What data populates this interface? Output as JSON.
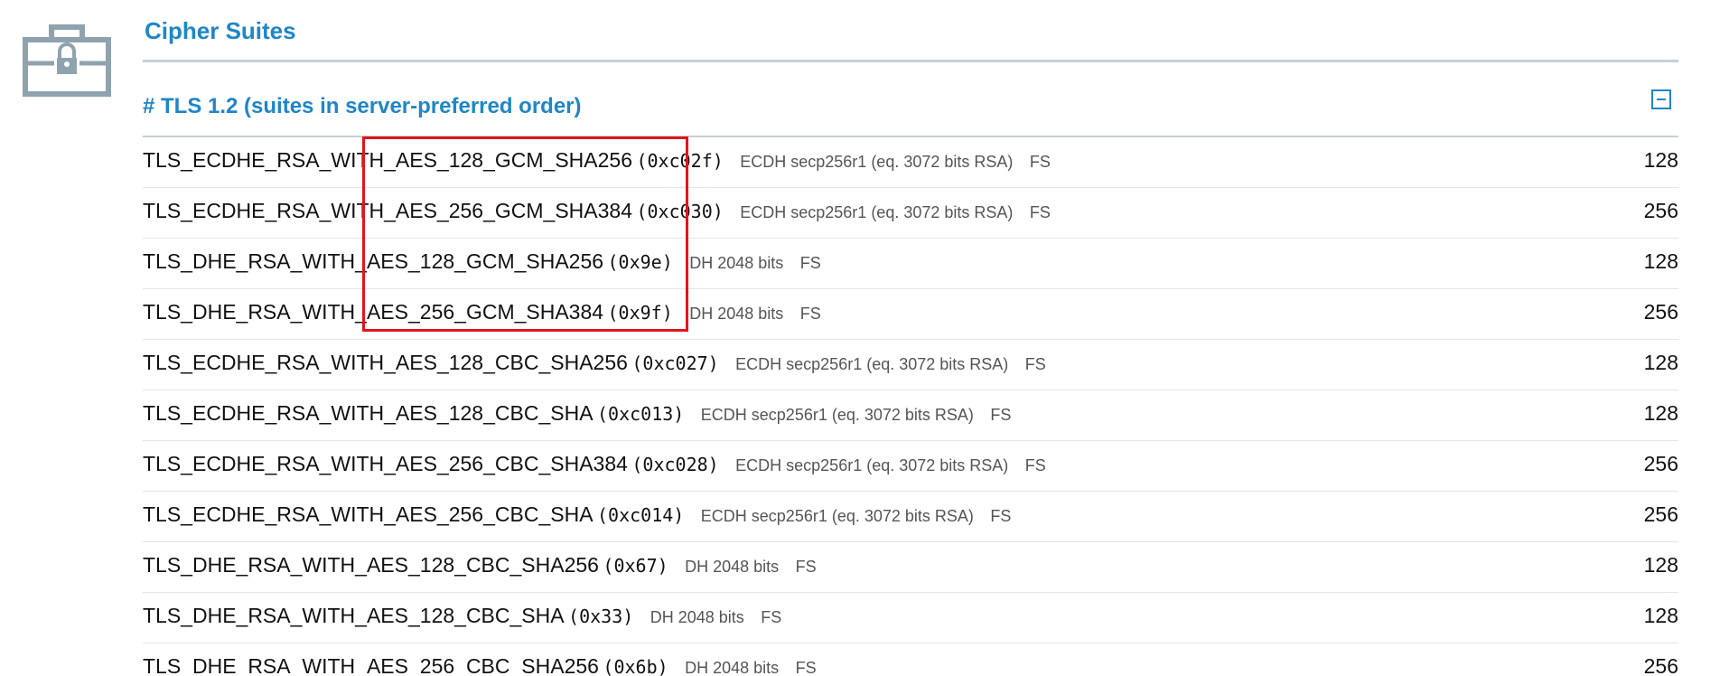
{
  "section": {
    "title": "Cipher Suites",
    "icon": "lock-briefcase-icon",
    "colors": {
      "accent": "#1f86c7",
      "icon": "#8fa3ae",
      "highlight": "#e3141b"
    }
  },
  "protocol": {
    "header": "# TLS 1.2 (suites in server-preferred order)",
    "collapse_icon": "minus-square-icon"
  },
  "suites": [
    {
      "name": "TLS_ECDHE_RSA_WITH_AES_128_GCM_SHA256",
      "code": "(0xc02f)",
      "kex": "ECDH secp256r1 (eq. 3072 bits RSA)",
      "fs": "FS",
      "bits": "128"
    },
    {
      "name": "TLS_ECDHE_RSA_WITH_AES_256_GCM_SHA384",
      "code": "(0xc030)",
      "kex": "ECDH secp256r1 (eq. 3072 bits RSA)",
      "fs": "FS",
      "bits": "256"
    },
    {
      "name": "TLS_DHE_RSA_WITH_AES_128_GCM_SHA256",
      "code": "(0x9e)",
      "kex": "DH 2048 bits",
      "fs": "FS",
      "bits": "128"
    },
    {
      "name": "TLS_DHE_RSA_WITH_AES_256_GCM_SHA384",
      "code": "(0x9f)",
      "kex": "DH 2048 bits",
      "fs": "FS",
      "bits": "256"
    },
    {
      "name": "TLS_ECDHE_RSA_WITH_AES_128_CBC_SHA256",
      "code": "(0xc027)",
      "kex": "ECDH secp256r1 (eq. 3072 bits RSA)",
      "fs": "FS",
      "bits": "128"
    },
    {
      "name": "TLS_ECDHE_RSA_WITH_AES_128_CBC_SHA",
      "code": "(0xc013)",
      "kex": "ECDH secp256r1 (eq. 3072 bits RSA)",
      "fs": "FS",
      "bits": "128"
    },
    {
      "name": "TLS_ECDHE_RSA_WITH_AES_256_CBC_SHA384",
      "code": "(0xc028)",
      "kex": "ECDH secp256r1 (eq. 3072 bits RSA)",
      "fs": "FS",
      "bits": "256"
    },
    {
      "name": "TLS_ECDHE_RSA_WITH_AES_256_CBC_SHA",
      "code": "(0xc014)",
      "kex": "ECDH secp256r1 (eq. 3072 bits RSA)",
      "fs": "FS",
      "bits": "256"
    },
    {
      "name": "TLS_DHE_RSA_WITH_AES_128_CBC_SHA256",
      "code": "(0x67)",
      "kex": "DH 2048 bits",
      "fs": "FS",
      "bits": "128"
    },
    {
      "name": "TLS_DHE_RSA_WITH_AES_128_CBC_SHA",
      "code": "(0x33)",
      "kex": "DH 2048 bits",
      "fs": "FS",
      "bits": "128"
    },
    {
      "name": "TLS_DHE_RSA_WITH_AES_256_CBC_SHA256",
      "code": "(0x6b)",
      "kex": "DH 2048 bits",
      "fs": "FS",
      "bits": "256"
    }
  ]
}
